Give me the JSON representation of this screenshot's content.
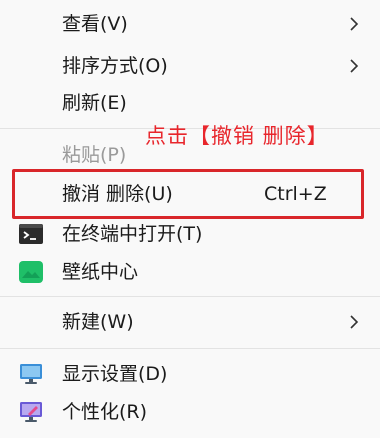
{
  "menu": {
    "items": [
      {
        "label": "查看(V)",
        "has_submenu": true
      },
      {
        "label": "排序方式(O)",
        "has_submenu": true
      },
      {
        "label": "刷新(E)"
      },
      {
        "label": "粘贴(P)",
        "disabled": true
      },
      {
        "label": "撤消 删除(U)",
        "shortcut": "Ctrl+Z"
      },
      {
        "label": "在终端中打开(T)",
        "icon": "terminal-icon"
      },
      {
        "label": "壁纸中心",
        "icon": "wallpaper-icon"
      },
      {
        "label": "新建(W)",
        "has_submenu": true
      },
      {
        "label": "显示设置(D)",
        "icon": "display-settings-icon"
      },
      {
        "label": "个性化(R)",
        "icon": "personalization-icon"
      }
    ]
  },
  "annotation": {
    "text": "点击【撤销 删除】"
  },
  "colors": {
    "highlight": "#d9262a",
    "annotation": "#e8262c"
  }
}
